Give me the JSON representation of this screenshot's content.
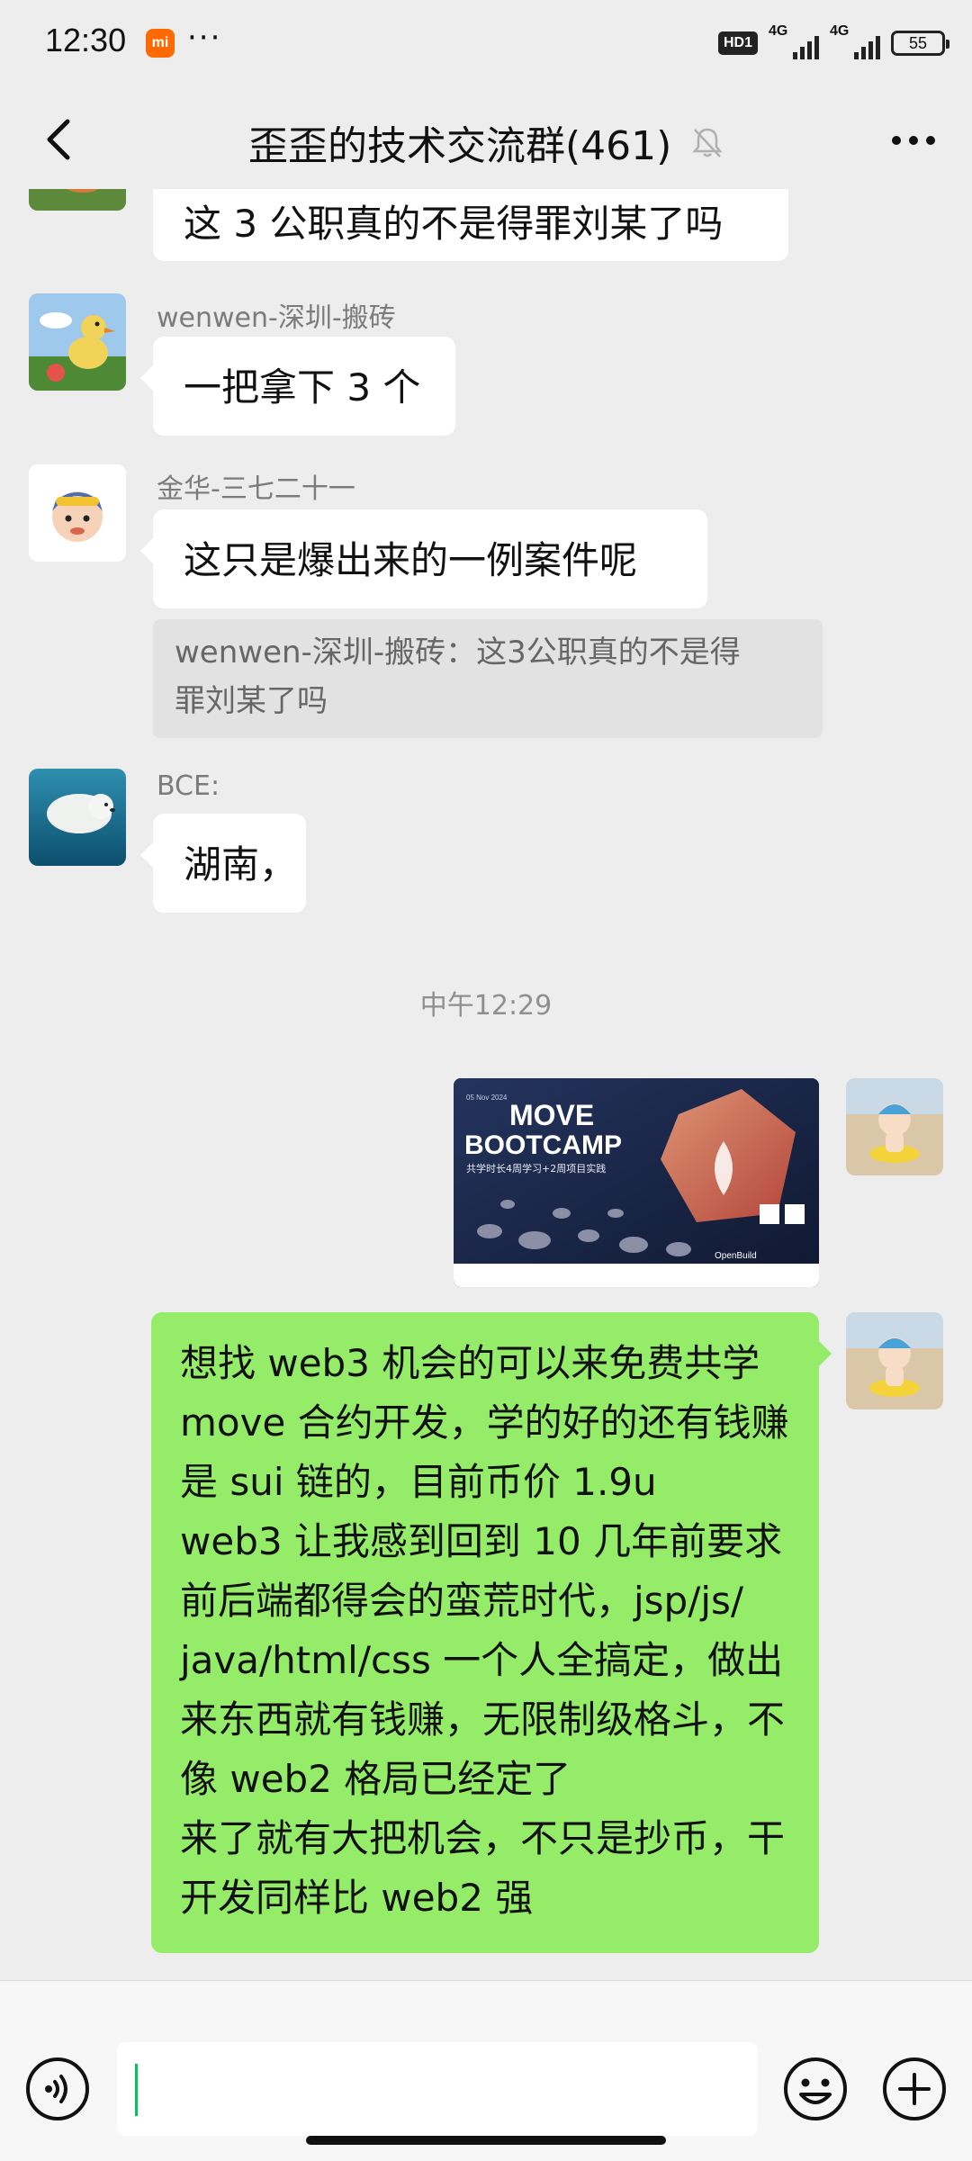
{
  "status_bar": {
    "time": "12:30",
    "app_badge": "mi",
    "dots": "···",
    "hd": "HD1",
    "network1": "4G",
    "network2": "4G",
    "battery": "55"
  },
  "header": {
    "title": "歪歪的技术交流群(461)"
  },
  "messages": [
    {
      "text": "这 3 公职真的不是得罪刘某了吗"
    },
    {
      "sender": "wenwen-深圳-搬砖",
      "text": "一把拿下 3 个"
    },
    {
      "sender": "金华-三七二十一",
      "text": "这只是爆出来的一例案件呢",
      "quote_line1": "wenwen-深圳-搬砖：这3公职真的不是得",
      "quote_line2": "罪刘某了吗"
    },
    {
      "sender": "BCE:",
      "text": "湖南，"
    }
  ],
  "time_separator": "中午12:29",
  "image_message": {
    "title_line1": "MOVE",
    "title_line2": "BOOTCAMP",
    "date_small": "05 Nov 2024",
    "subtitle": "共学时长4周学习+2周项目实践",
    "footer_text": "OpenBuild"
  },
  "own_message": {
    "lines": [
      "想找 web3 机会的可以来免费共学",
      "move 合约开发，学的好的还有钱赚",
      "是 sui 链的，目前币价 1.9u",
      "web3 让我感到回到 10 几年前要求",
      "前后端都得会的蛮荒时代，jsp/js/",
      "java/html/css 一个人全搞定，做出",
      "来东西就有钱赚，无限制级格斗，不",
      "像 web2 格局已经定了",
      "来了就有大把机会，不只是抄币，干",
      "开发同样比 web2 强"
    ]
  },
  "input": {
    "value": "",
    "placeholder": ""
  },
  "colors": {
    "background": "#ededed",
    "own_bubble": "#95ec69",
    "other_bubble": "#ffffff",
    "accent": "#07c160",
    "mi_badge": "#ff6a00"
  },
  "icons": {
    "back": "chevron-left-icon",
    "mute": "bell-off-icon",
    "more": "more-dots-icon",
    "voice": "voice-icon",
    "emoji": "emoji-icon",
    "add": "plus-circle-icon"
  }
}
